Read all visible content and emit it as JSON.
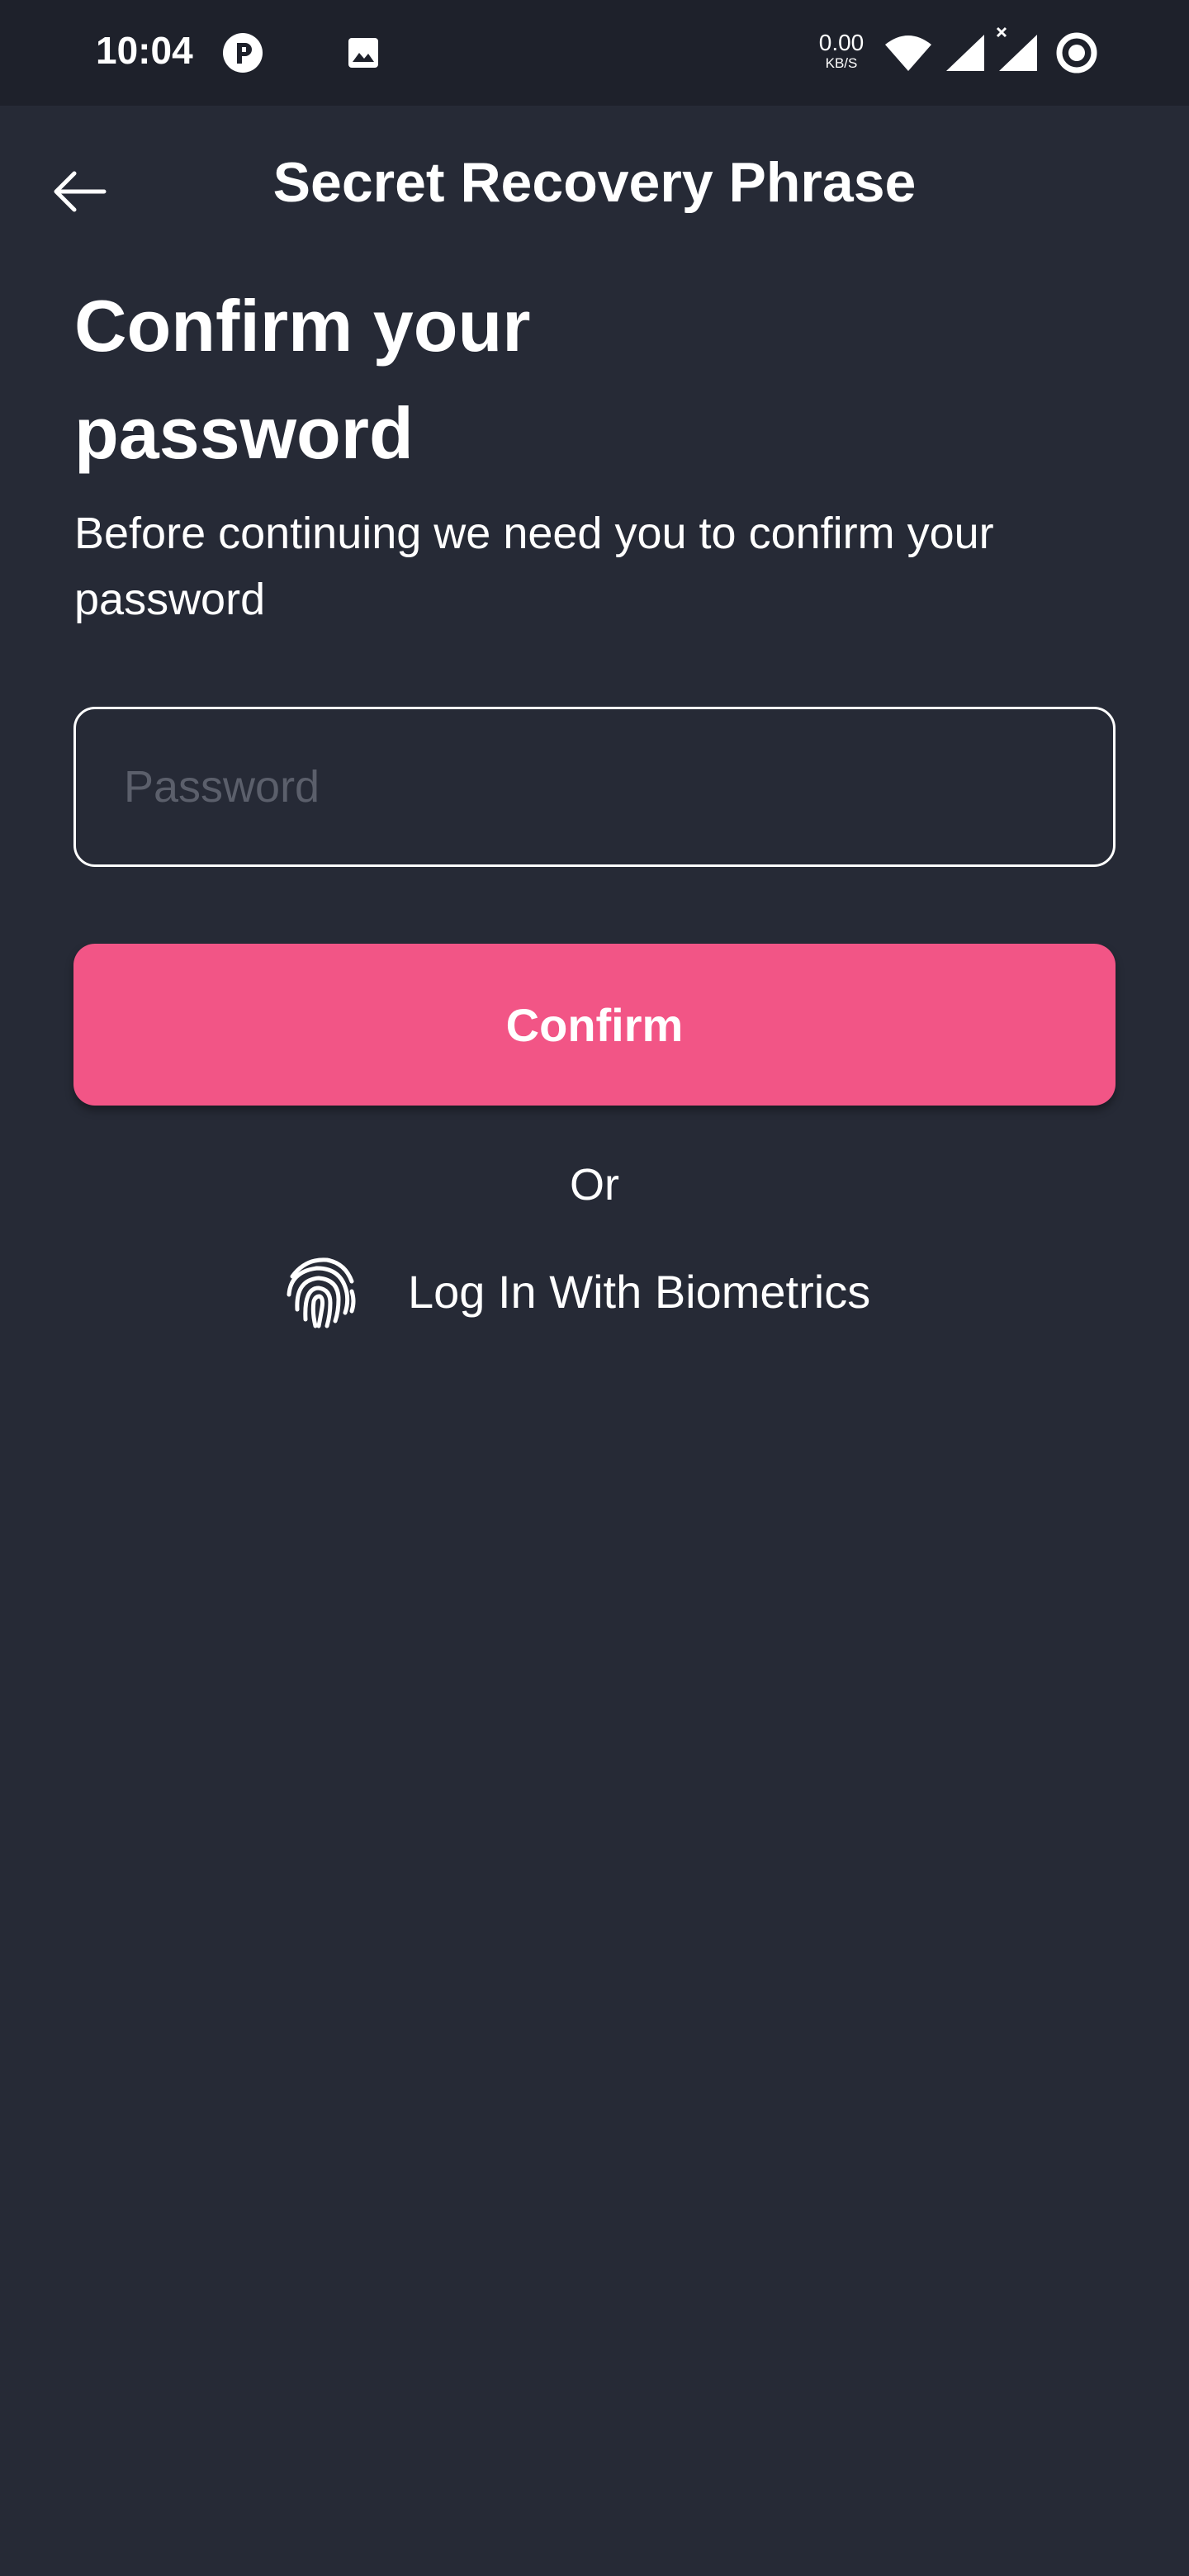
{
  "status_bar": {
    "time": "10:04",
    "net_speed_value": "0.00",
    "net_speed_unit": "KB/S"
  },
  "app_bar": {
    "title": "Secret Recovery Phrase"
  },
  "content": {
    "heading": "Confirm your password",
    "description": "Before continuing we need you to confirm your password",
    "password_placeholder": "Password",
    "password_value": "",
    "confirm_label": "Confirm",
    "or_label": "Or",
    "biometrics_label": "Log In With Biometrics"
  },
  "colors": {
    "background": "#262a36",
    "status_bar": "#1e212b",
    "accent": "#f25586",
    "placeholder": "#5b5f6b"
  },
  "icons": [
    "back-arrow-icon",
    "fingerprint-icon",
    "wifi-icon",
    "signal-icon",
    "image-icon"
  ]
}
